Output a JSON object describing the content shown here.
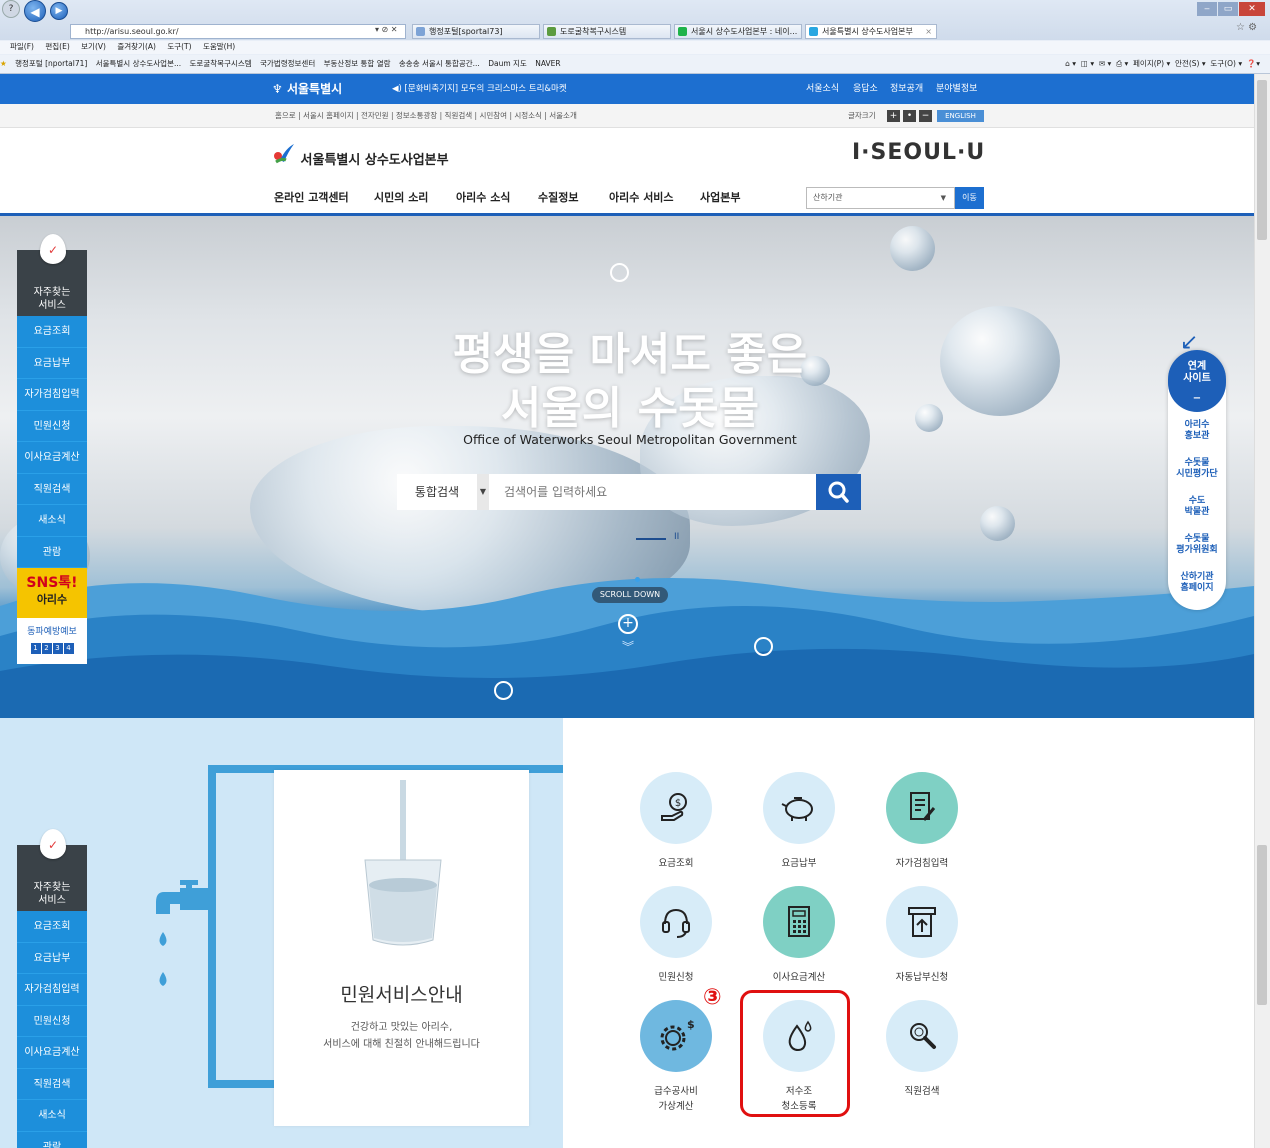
{
  "browser": {
    "url": "http://arisu.seoul.go.kr/",
    "addr_controls": "▾ ⊘ ✕",
    "tabs": [
      "행정포털[sportal73]",
      "도로굴착복구시스템",
      "서울시 상수도사업본부 : 네이...",
      "서울특별시 상수도사업본부"
    ],
    "tab_close": "×",
    "menu": [
      "파일(F)",
      "편집(E)",
      "보기(V)",
      "즐겨찾기(A)",
      "도구(T)",
      "도움말(H)"
    ],
    "favorites": [
      "행정포털 [nportal71]",
      "서울특별시 상수도사업본...",
      "도로굴착복구시스템",
      "국가법령정보센터",
      "부동산정보 통합 열람",
      "송송송 서울시 통합공간...",
      "Daum 지도",
      "NAVER"
    ],
    "commands": [
      "페이지(P) ▾",
      "안전(S) ▾",
      "도구(O) ▾"
    ]
  },
  "site": {
    "top_logo": "서울특별시",
    "notice": "◀) [문화비축기지] 모두의 크리스마스 트리&마켓",
    "top_links": [
      "서울소식",
      "응답소",
      "정보공개",
      "분야별정보"
    ],
    "util_links": "홈으로 | 서울시 홈페이지 | 전자민원 | 정보소통광장 | 직원검색 | 시민참여 | 시정소식 | 서울소개",
    "font_size_label": "글자크기",
    "font_btns": [
      "+",
      "•",
      "−"
    ],
    "english": "ENGLISH",
    "org_logo": "서울특별시 상수도사업본부",
    "brand": "I·SEOUL·U",
    "gnb": [
      "온라인 고객센터",
      "시민의 소리",
      "아리수 소식",
      "수질정보",
      "아리수 서비스",
      "사업본부"
    ],
    "org_select": "산하기관",
    "org_go": "이동"
  },
  "hero": {
    "title1": "평생을 마셔도 좋은",
    "title2": "서울의 수돗물",
    "subtitle": "Office of Waterworks Seoul Metropolitan Government",
    "search_category": "통합검색",
    "search_placeholder": "검색어를 입력하세요",
    "pause": "II",
    "scroll_down": "SCROLL DOWN"
  },
  "quick": {
    "title": "자주찾는\n서비스",
    "items": [
      "요금조회",
      "요금납부",
      "자가검침입력",
      "민원신청",
      "이사요금계산",
      "직원검색",
      "새소식",
      "관람"
    ],
    "sns_top": "SNS톡!",
    "sns_bottom": "아리수",
    "forecast": "동파예방예보",
    "pages": [
      "1",
      "2",
      "3",
      "4"
    ]
  },
  "linked": {
    "title": "연계\n사이트",
    "items": [
      "아리수\n홍보관",
      "수돗물\n시민평가단",
      "수도\n박물관",
      "수돗물\n평가위원회",
      "산하기관\n홈페이지"
    ]
  },
  "service": {
    "title": "민원서비스안내",
    "desc1": "건강하고 맛있는 아리수,",
    "desc2": "서비스에 대해 친절히 안내해드립니다",
    "items": [
      {
        "label": "요금조회",
        "icon": "fee-inquiry-icon"
      },
      {
        "label": "요금납부",
        "icon": "piggy-bank-icon"
      },
      {
        "label": "자가검침입력",
        "icon": "meter-input-icon"
      },
      {
        "label": "민원신청",
        "icon": "headset-icon"
      },
      {
        "label": "이사요금계산",
        "icon": "calculator-icon"
      },
      {
        "label": "자동납부신청",
        "icon": "auto-pay-icon"
      },
      {
        "label": "급수공사비\n가상계산",
        "icon": "gear-dollar-icon"
      },
      {
        "label": "저수조\n청소등록",
        "icon": "water-drop-icon"
      },
      {
        "label": "직원검색",
        "icon": "magnifier-icon"
      }
    ],
    "annotation": "③"
  }
}
